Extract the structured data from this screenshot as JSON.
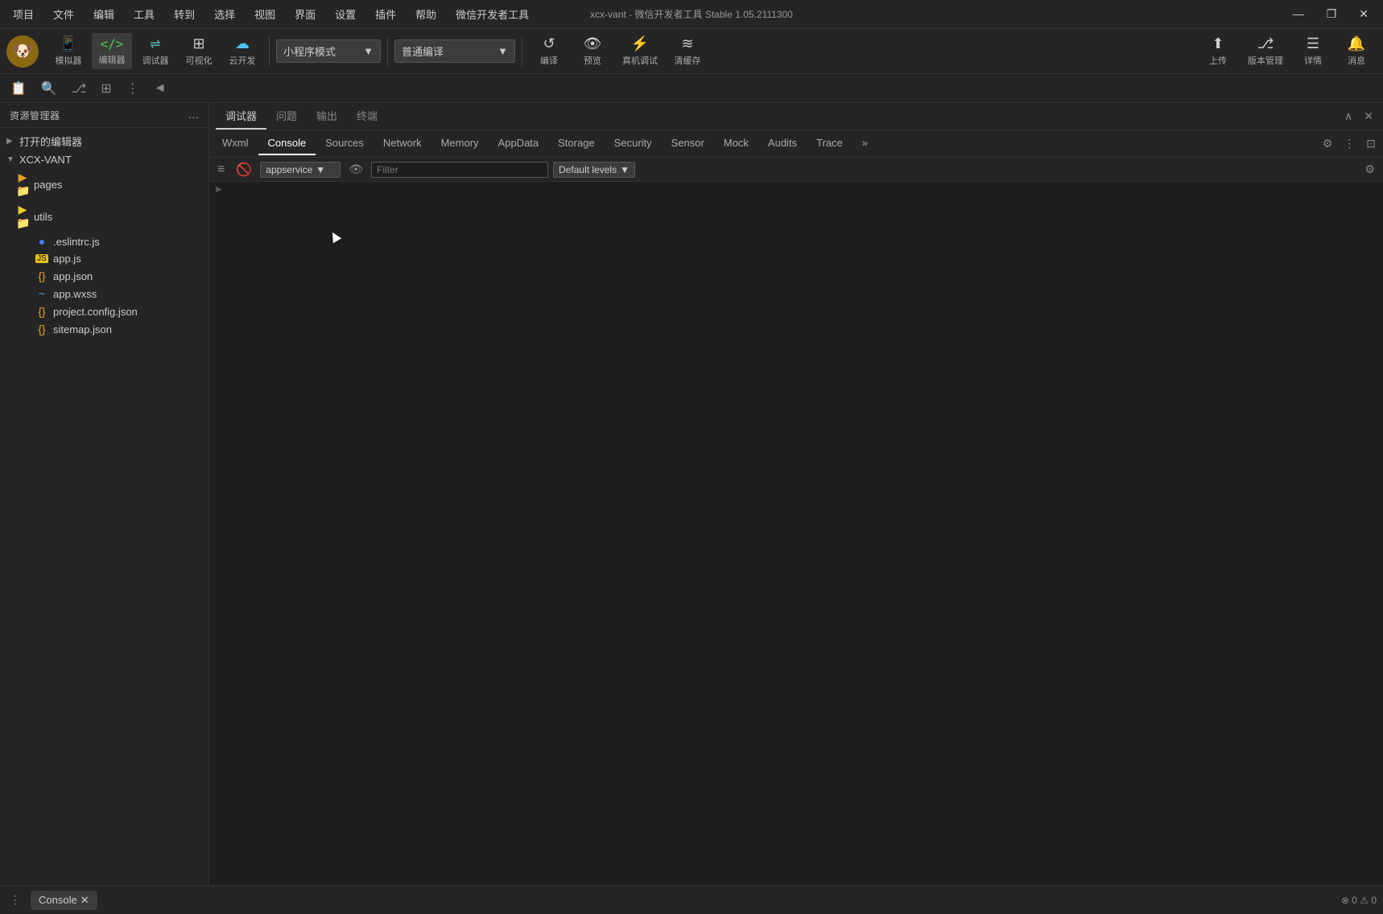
{
  "titleBar": {
    "menus": [
      "项目",
      "文件",
      "编辑",
      "工具",
      "转到",
      "选择",
      "视图",
      "界面",
      "设置",
      "插件",
      "帮助",
      "微信开发者工具"
    ],
    "title": "xcx-vant - 微信开发者工具 Stable 1.05.2111300",
    "windowControls": {
      "minimize": "—",
      "maximize": "❐",
      "close": "✕"
    }
  },
  "toolbar": {
    "logo": "🐶",
    "tools": [
      {
        "id": "simulator",
        "icon": "📱",
        "label": "模拟器"
      },
      {
        "id": "editor",
        "icon": "</>",
        "label": "编辑器",
        "active": true
      },
      {
        "id": "debugger",
        "icon": "⇌",
        "label": "调试器"
      },
      {
        "id": "visual",
        "icon": "⊞",
        "label": "可视化"
      },
      {
        "id": "cloud",
        "icon": "☁",
        "label": "云开发"
      }
    ],
    "modeSelector": {
      "value": "小程序模式",
      "arrow": "▼"
    },
    "compileSelector": {
      "value": "普通编译",
      "arrow": "▼"
    },
    "rightTools": [
      {
        "id": "compile",
        "icon": "↺",
        "label": "编译"
      },
      {
        "id": "preview",
        "icon": "👁",
        "label": "预览"
      },
      {
        "id": "real-debug",
        "icon": "⚡",
        "label": "真机调试"
      },
      {
        "id": "clear-cache",
        "icon": "≋",
        "label": "清缓存"
      }
    ],
    "farRightTools": [
      {
        "id": "upload",
        "icon": "↑",
        "label": "上传"
      },
      {
        "id": "version",
        "icon": "⎇",
        "label": "版本管理"
      },
      {
        "id": "detail",
        "icon": "☰",
        "label": "详情"
      },
      {
        "id": "notification",
        "icon": "🔔",
        "label": "消息"
      }
    ]
  },
  "iconBar": {
    "buttons": [
      "📋",
      "🔍",
      "⎇",
      "⊞",
      "⋮",
      "◄"
    ]
  },
  "sidebar": {
    "title": "资源管理器",
    "moreIcon": "...",
    "sections": [
      {
        "id": "open-editors",
        "label": "打开的编辑器",
        "collapsed": true,
        "chevron": "▶"
      },
      {
        "id": "xcx-vant",
        "label": "XCX-VANT",
        "collapsed": false,
        "chevron": "▼",
        "children": [
          {
            "id": "pages",
            "type": "folder-orange",
            "name": "pages",
            "icon": "📁"
          },
          {
            "id": "utils",
            "type": "folder-yellow",
            "name": "utils",
            "icon": "📁"
          },
          {
            "id": "eslintrc",
            "type": "file-eslint",
            "name": ".eslintrc.js",
            "icon": "●"
          },
          {
            "id": "app-js",
            "type": "file-js",
            "name": "app.js",
            "icon": "JS"
          },
          {
            "id": "app-json",
            "type": "file-json",
            "name": "app.json",
            "icon": "{}"
          },
          {
            "id": "app-wxss",
            "type": "file-wxss",
            "name": "app.wxss",
            "icon": "~"
          },
          {
            "id": "project-config",
            "type": "file-json",
            "name": "project.config.json",
            "icon": "{}"
          },
          {
            "id": "sitemap",
            "type": "file-json",
            "name": "sitemap.json",
            "icon": "{}"
          }
        ]
      }
    ]
  },
  "panelTabs": {
    "tabs": [
      {
        "id": "debugger",
        "label": "调试器",
        "active": true
      },
      {
        "id": "issue",
        "label": "问题"
      },
      {
        "id": "output",
        "label": "输出"
      },
      {
        "id": "terminal",
        "label": "终端"
      }
    ],
    "controls": {
      "expand": "∧",
      "close": "✕"
    }
  },
  "devtoolsTabs": {
    "tabs": [
      {
        "id": "wxml",
        "label": "Wxml"
      },
      {
        "id": "console",
        "label": "Console",
        "active": true
      },
      {
        "id": "sources",
        "label": "Sources"
      },
      {
        "id": "network",
        "label": "Network"
      },
      {
        "id": "memory",
        "label": "Memory"
      },
      {
        "id": "appdata",
        "label": "AppData"
      },
      {
        "id": "storage",
        "label": "Storage"
      },
      {
        "id": "security",
        "label": "Security"
      },
      {
        "id": "sensor",
        "label": "Sensor"
      },
      {
        "id": "mock",
        "label": "Mock"
      },
      {
        "id": "audits",
        "label": "Audits"
      },
      {
        "id": "trace",
        "label": "Trace"
      },
      {
        "id": "more",
        "label": "»"
      }
    ],
    "controls": {
      "settings": "⚙",
      "more": "⋮",
      "expand": "⊡"
    }
  },
  "consoleToolbar": {
    "clearBtn": "🚫",
    "filterInput": {
      "placeholder": "Filter",
      "value": ""
    },
    "appserviceSelector": {
      "value": "appservice",
      "arrow": "▼"
    },
    "eyeIcon": "👁",
    "levelSelector": {
      "value": "Default levels",
      "arrow": "▼"
    },
    "settingsIcon": "⚙"
  },
  "consoleContent": {
    "promptChar": ">"
  },
  "statusBar": {
    "consoleTabLabel": "Console",
    "closeIcon": "✕",
    "moreIcon": "⋮",
    "statusLeft": "⊗ 0  ⚠ 0"
  },
  "colors": {
    "background": "#1e1e1e",
    "sidebar": "#252526",
    "border": "#333333",
    "activeTab": "#ffffff",
    "accentGreen": "#4ec94e",
    "accentBlue": "#4fc3f7"
  }
}
